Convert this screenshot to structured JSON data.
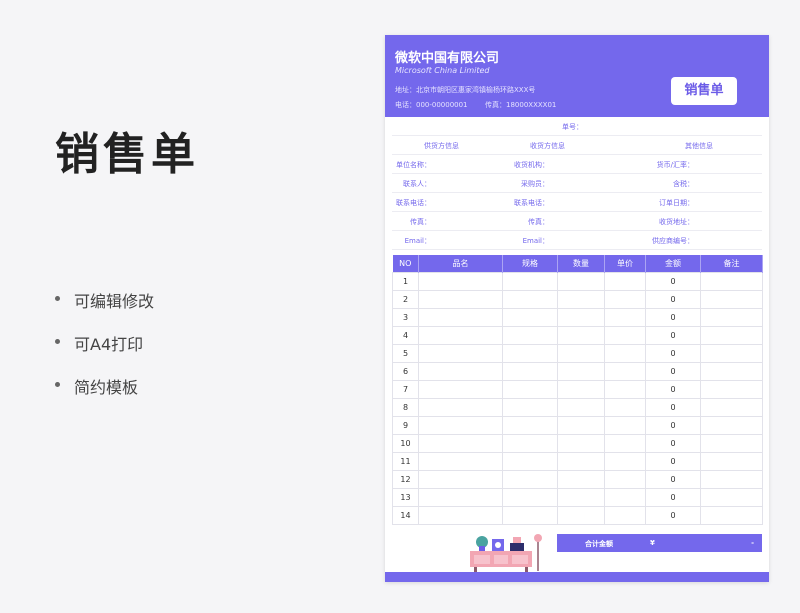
{
  "left": {
    "title": "销售单",
    "features": [
      "可编辑修改",
      "可A4打印",
      "简约模板"
    ]
  },
  "header": {
    "company_cn": "微软中国有限公司",
    "company_en": "Microsoft China Limited",
    "address": "地址：北京市朝阳区惠家湾镇榆杨环路XXX号",
    "phone": "电话：000-00000001",
    "fax": "传真：18000XXXX01",
    "doc_label": "销售单"
  },
  "info": {
    "order_no": "单号：",
    "supplier_info": "供货方信息",
    "receiver_info": "收货方信息",
    "other_info": "其他信息",
    "rows": [
      [
        "单位名称：",
        "收货机构：",
        "货币/汇率："
      ],
      [
        "联系人：",
        "采购员：",
        "含税："
      ],
      [
        "联系电话：",
        "联系电话：",
        "订单日期："
      ],
      [
        "传真：",
        "传真：",
        "收货地址："
      ],
      [
        "Email：",
        "Email：",
        "供应商编号："
      ]
    ]
  },
  "table": {
    "headers": [
      "NO",
      "品名",
      "规格",
      "数量",
      "单价",
      "金额",
      "备注"
    ],
    "rows": [
      {
        "no": "1",
        "amount": "0"
      },
      {
        "no": "2",
        "amount": "0"
      },
      {
        "no": "3",
        "amount": "0"
      },
      {
        "no": "4",
        "amount": "0"
      },
      {
        "no": "5",
        "amount": "0"
      },
      {
        "no": "6",
        "amount": "0"
      },
      {
        "no": "7",
        "amount": "0"
      },
      {
        "no": "8",
        "amount": "0"
      },
      {
        "no": "9",
        "amount": "0"
      },
      {
        "no": "10",
        "amount": "0"
      },
      {
        "no": "11",
        "amount": "0"
      },
      {
        "no": "12",
        "amount": "0"
      },
      {
        "no": "13",
        "amount": "0"
      },
      {
        "no": "14",
        "amount": "0"
      }
    ]
  },
  "total": {
    "label": "合计金额",
    "currency": "¥",
    "value": "-"
  },
  "colors": {
    "accent": "#7468ec",
    "background": "#f5f5f7"
  }
}
